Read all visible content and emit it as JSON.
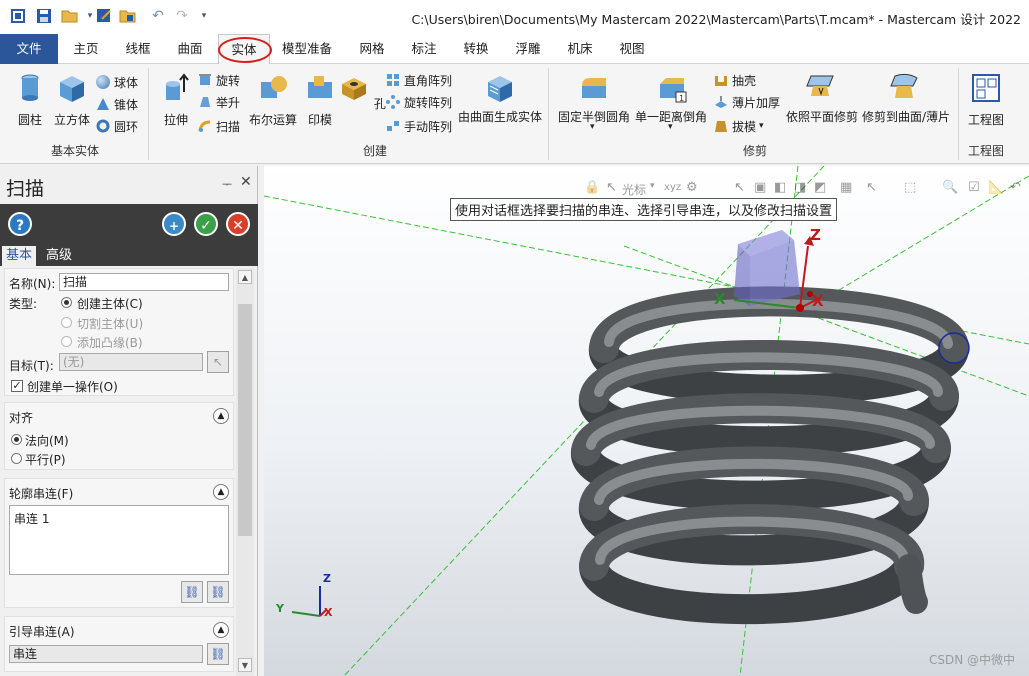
{
  "window": {
    "title": "C:\\Users\\biren\\Documents\\My Mastercam 2022\\Mastercam\\Parts\\T.mcam* - Mastercam 设计 2022"
  },
  "tabs": [
    {
      "label": "文件"
    },
    {
      "label": "主页"
    },
    {
      "label": "线框"
    },
    {
      "label": "曲面"
    },
    {
      "label": "实体"
    },
    {
      "label": "模型准备"
    },
    {
      "label": "网格"
    },
    {
      "label": "标注"
    },
    {
      "label": "转换"
    },
    {
      "label": "浮雕"
    },
    {
      "label": "机床"
    },
    {
      "label": "视图"
    }
  ],
  "ribbon": {
    "basic": {
      "label": "基本实体",
      "cylinder": "圆柱",
      "cube": "立方体",
      "sphere": "球体",
      "cone": "锥体",
      "torus": "圆环"
    },
    "create": {
      "label": "创建",
      "extrude": "拉伸",
      "revolve": "旋转",
      "loft": "举升",
      "sweep": "扫描",
      "boolean": "布尔运算",
      "imprint": "印模",
      "hole": "孔",
      "rect_array": "直角阵列",
      "rot_array": "旋转阵列",
      "manual_array": "手动阵列",
      "from_surfaces": "由曲面生成实体"
    },
    "modify": {
      "label": "修剪",
      "fillet": "固定半倒圆角",
      "chamfer": "单一距离倒角",
      "shell": "抽壳",
      "thicken": "薄片加厚",
      "draft": "拔模",
      "trim_plane": "依照平面修剪",
      "trim_surface": "修剪到曲面/薄片"
    },
    "drawing": {
      "label": "工程图",
      "layout": "工程图"
    }
  },
  "panel": {
    "title": "扫描",
    "tab_basic": "基本",
    "tab_advanced": "高级",
    "name_label": "名称(N):",
    "name_value": "扫描",
    "type_label": "类型:",
    "type_create": "创建主体(C)",
    "type_cut": "切割主体(U)",
    "type_boss": "添加凸缘(B)",
    "target_label": "目标(T):",
    "target_value": "(无)",
    "single_op": "创建单一操作(O)",
    "align_title": "对齐",
    "align_normal": "法向(M)",
    "align_parallel": "平行(P)",
    "profile_title": "轮廓串连(F)",
    "profile_item": "串连 1",
    "guide_title": "引导串连(A)",
    "guide_value": "串连"
  },
  "viewport": {
    "tooltip": "使用对话框选择要扫描的串连、选择引导串连，以及修改扫描设置",
    "cursor_label": "光标",
    "axis_z": "Z",
    "axis_x": "X",
    "axis_y": "Y",
    "watermark": "CSDN @中微中"
  },
  "colors": {
    "accent": "#2b579a",
    "highlight_ring": "#d62020",
    "spring": "#6a6d70"
  }
}
